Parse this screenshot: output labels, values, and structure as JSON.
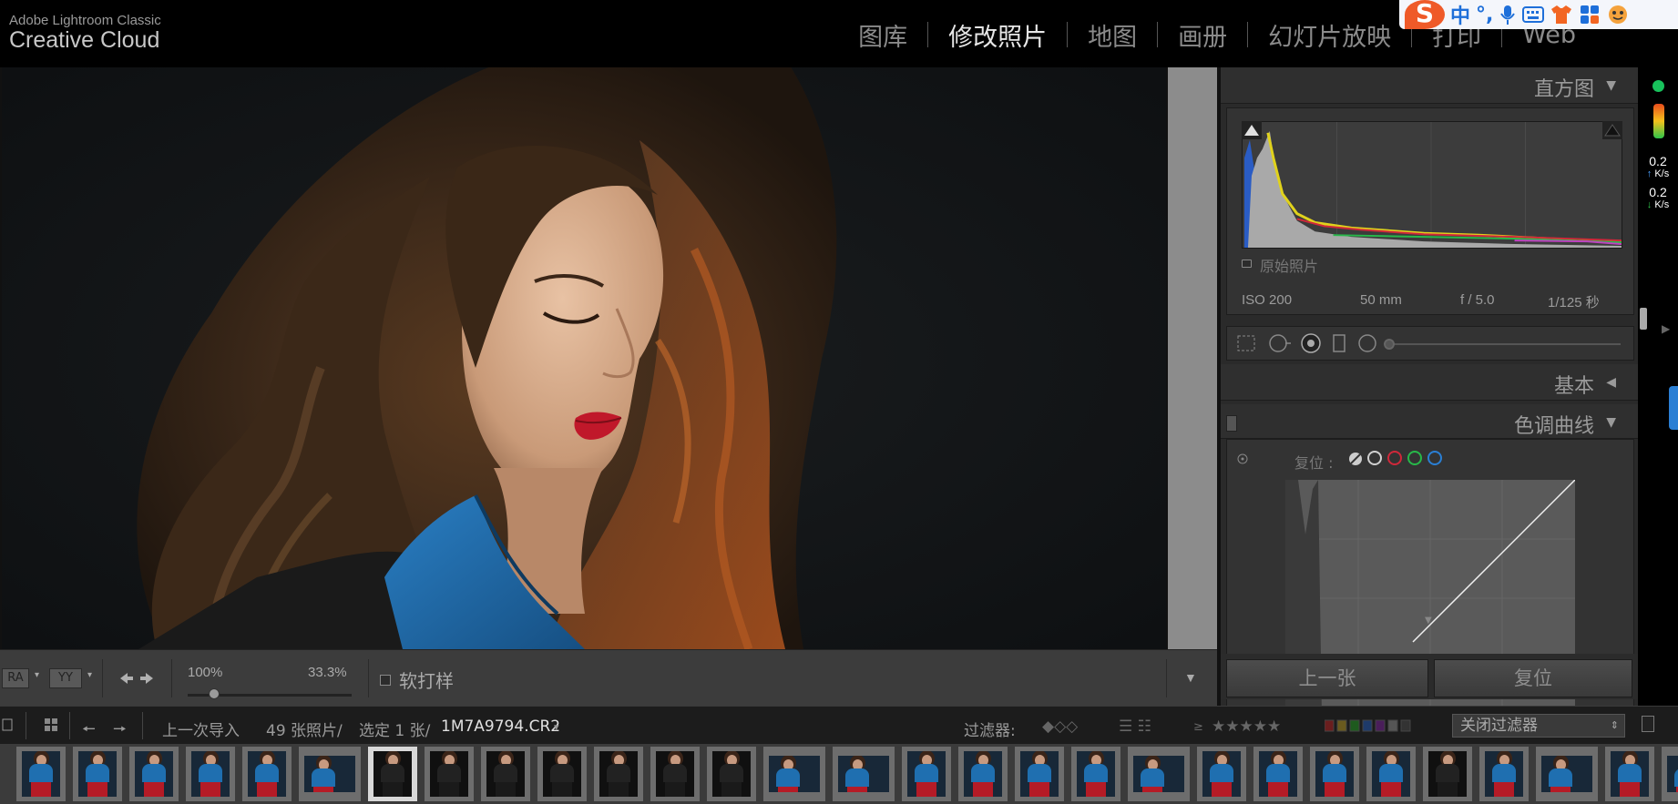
{
  "app": {
    "brand_small": "Adobe Lightroom Classic",
    "brand_large": "Creative Cloud"
  },
  "modules": [
    {
      "label": "图库",
      "active": false
    },
    {
      "label": "修改照片",
      "active": true
    },
    {
      "label": "地图",
      "active": false
    },
    {
      "label": "画册",
      "active": false
    },
    {
      "label": "幻灯片放映",
      "active": false
    },
    {
      "label": "打印",
      "active": false
    },
    {
      "label": "Web",
      "active": false
    }
  ],
  "ime": {
    "logo": "S",
    "lang": "中",
    "punct": "°,"
  },
  "toolbar": {
    "view_btn_1": "RA",
    "view_btn_2": "YY",
    "zoom_left": "100%",
    "zoom_right": "33.3%",
    "zoom_level": 0.16,
    "soft_proof": "软打样"
  },
  "histogram": {
    "title": "直方图",
    "iso": "ISO 200",
    "focal": "50 mm",
    "aperture": "f / 5.0",
    "shutter": "1/125 秒",
    "original_label": "原始照片"
  },
  "basic": {
    "title": "基本"
  },
  "tone_curve": {
    "title": "色调曲线",
    "reset_label": "复位 :"
  },
  "buttons": {
    "previous": "上一张",
    "reset": "复位"
  },
  "network": {
    "up_value": "0.2",
    "up_unit": "K/s",
    "down_value": "0.2",
    "down_unit": "K/s"
  },
  "filmbar": {
    "source": "上一次导入",
    "count": "49 张照片/",
    "selected": "选定 1 张/",
    "filename": "1M7A9794.CR2",
    "filter_label": "过滤器:",
    "rating_prefix": "≥",
    "stars": "★★★★★",
    "filter_select": "关闭过滤器"
  },
  "colors": {
    "accent": "#e6e6e6",
    "panel": "#2a2a2a",
    "lip_red": "#c0182a",
    "shirt_blue": "#1f6fb0"
  }
}
